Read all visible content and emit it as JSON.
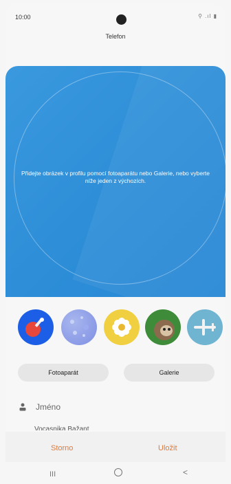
{
  "status": {
    "time": "10:00",
    "icons": "⚲ .ıl ▮"
  },
  "header": {
    "title": "Telefon"
  },
  "hero": {
    "text": "Přidejte obrázek v profilu pomocí fotoaparátu nebo Galerie, nebo vyberte níže jeden z výchozích."
  },
  "buttons": {
    "camera": "Fotoaparát",
    "gallery": "Galerie"
  },
  "form": {
    "name_placeholder": "Jméno",
    "partial_text": "Vocasnika Bažant"
  },
  "actions": {
    "cancel": "Storno",
    "save": "Uložit"
  },
  "nav": {
    "recent": "III",
    "back": "<"
  },
  "colors": {
    "accent": "#e0793a",
    "hero": "#2f8fd8"
  },
  "avatars": [
    "ping-pong-paddle-icon",
    "bubbles-avatar-icon",
    "flower-avatar-icon",
    "sloth-avatar-icon",
    "airplane-avatar-icon"
  ]
}
